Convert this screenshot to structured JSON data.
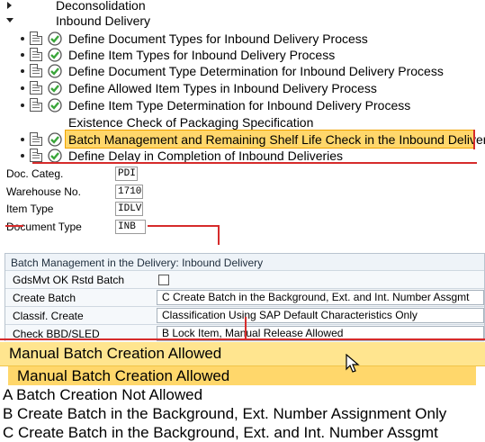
{
  "tree": {
    "nodes": [
      {
        "label": "Deconsolidation",
        "kind": "folder"
      },
      {
        "label": "Inbound Delivery",
        "kind": "folder"
      },
      {
        "label": "Define Document Types for Inbound Delivery Process",
        "kind": "activity"
      },
      {
        "label": "Define Item Types for Inbound Delivery Process",
        "kind": "activity"
      },
      {
        "label": "Define Document Type Determination for Inbound Delivery Process",
        "kind": "activity"
      },
      {
        "label": "Define Allowed Item Types in Inbound Delivery Process",
        "kind": "activity"
      },
      {
        "label": "Define Item Type Determination for Inbound Delivery Process",
        "kind": "activity"
      },
      {
        "label": "Existence Check of Packaging Specification",
        "kind": "plain"
      },
      {
        "label": "Batch Management and Remaining Shelf Life Check in the Inbound Delivery",
        "kind": "activity",
        "selected": true
      },
      {
        "label": "Define Delay in Completion of Inbound Deliveries",
        "kind": "activity"
      }
    ],
    "icons": {
      "doc": "customizing-doc-icon",
      "exec": "execute-clock-icon"
    }
  },
  "fields": {
    "doc_categ": {
      "label": "Doc. Categ.",
      "value": "PDI"
    },
    "warehouse": {
      "label": "Warehouse No.",
      "value": "1710"
    },
    "item_type": {
      "label": "Item Type",
      "value": "IDLV"
    },
    "doc_type": {
      "label": "Document Type",
      "value": "INB"
    }
  },
  "panel": {
    "title": "Batch Management in the Delivery: Inbound Delivery",
    "rows": [
      {
        "label": "GdsMvt OK Rstd Batch",
        "value": "",
        "type": "checkbox",
        "checked": false
      },
      {
        "label": "Create Batch",
        "value": "C Create Batch in the Background, Ext. and Int. Number Assgmt",
        "type": "select"
      },
      {
        "label": "Classif. Create",
        "value": "Classification Using SAP Default Characteristics Only",
        "type": "select"
      },
      {
        "label": "Check BBD/SLED",
        "value": "B Lock Item, Manual Release Allowed",
        "type": "select"
      }
    ]
  },
  "dropdown": {
    "current": "Manual Batch Creation Allowed",
    "options": [
      "Manual Batch Creation Allowed",
      "A Batch Creation Not Allowed",
      "B Create Batch in the Background, Ext. Number Assignment Only",
      "C Create Batch in the Background, Ext. and Int. Number Assgmt"
    ]
  },
  "colors": {
    "highlight": "#ffd76b",
    "highlight_border": "#f0a300",
    "annotation_red": "#d62b2b",
    "exec_green": "#3aa63a"
  }
}
